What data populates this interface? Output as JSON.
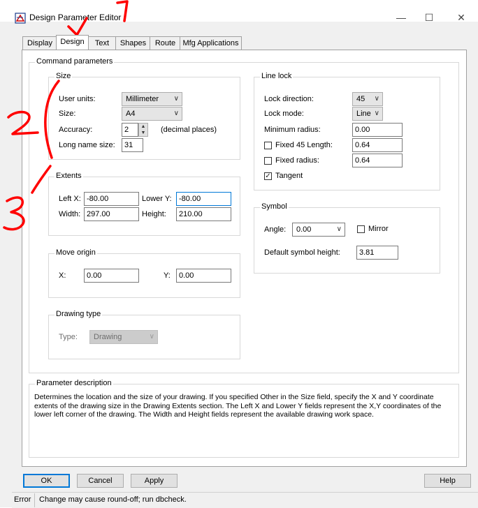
{
  "window": {
    "title": "Design Parameter Editor",
    "icon": "app-icon",
    "controls": [
      "minimize-icon",
      "maximize-icon",
      "close-icon"
    ]
  },
  "tabs": [
    {
      "label": "Display"
    },
    {
      "label": "Design",
      "active": true
    },
    {
      "label": "Text"
    },
    {
      "label": "Shapes"
    },
    {
      "label": "Route"
    },
    {
      "label": "Mfg Applications"
    }
  ],
  "command_params": {
    "title": "Command parameters"
  },
  "size": {
    "title": "Size",
    "user_units_label": "User units:",
    "user_units_value": "Millimeter",
    "size_label": "Size:",
    "size_value": "A4",
    "accuracy_label": "Accuracy:",
    "accuracy_value": "2",
    "accuracy_hint": "(decimal places)",
    "long_name_label": "Long name size:",
    "long_name_value": "31"
  },
  "extents": {
    "title": "Extents",
    "left_x_label": "Left X:",
    "left_x_value": "-80.00",
    "lower_y_label": "Lower Y:",
    "lower_y_value": "-80.00",
    "width_label": "Width:",
    "width_value": "297.00",
    "height_label": "Height:",
    "height_value": "210.00"
  },
  "move_origin": {
    "title": "Move origin",
    "x_label": "X:",
    "x_value": "0.00",
    "y_label": "Y:",
    "y_value": "0.00"
  },
  "drawing_type": {
    "title": "Drawing type",
    "type_label": "Type:",
    "type_value": "Drawing"
  },
  "line_lock": {
    "title": "Line lock",
    "lock_direction_label": "Lock direction:",
    "lock_direction_value": "45",
    "lock_mode_label": "Lock mode:",
    "lock_mode_value": "Line",
    "min_radius_label": "Minimum radius:",
    "min_radius_value": "0.00",
    "fixed45_label": "Fixed 45 Length:",
    "fixed45_value": "0.64",
    "fixed45_checked": false,
    "fixed_radius_label": "Fixed radius:",
    "fixed_radius_value": "0.64",
    "fixed_radius_checked": false,
    "tangent_label": "Tangent",
    "tangent_checked": true
  },
  "symbol": {
    "title": "Symbol",
    "angle_label": "Angle:",
    "angle_value": "0.00",
    "mirror_label": "Mirror",
    "mirror_checked": false,
    "default_height_label": "Default symbol height:",
    "default_height_value": "3.81"
  },
  "param_desc": {
    "title": "Parameter description",
    "text": "Determines the location and the size of your drawing.  If you specified Other in the Size field, specify the X and Y coordinate extents of the drawing size in the Drawing Extents section. The Left X and Lower Y fields represent the X,Y coordinates of the lower left corner of the drawing.  The Width and Height fields represent the available drawing work space."
  },
  "buttons": {
    "ok": "OK",
    "cancel": "Cancel",
    "apply": "Apply",
    "help": "Help"
  },
  "status": {
    "label": "Error",
    "message": "Change may cause round-off; run dbcheck."
  },
  "annotations": {
    "color": "#ff0000",
    "numbers": [
      "1",
      "2",
      "3"
    ]
  }
}
